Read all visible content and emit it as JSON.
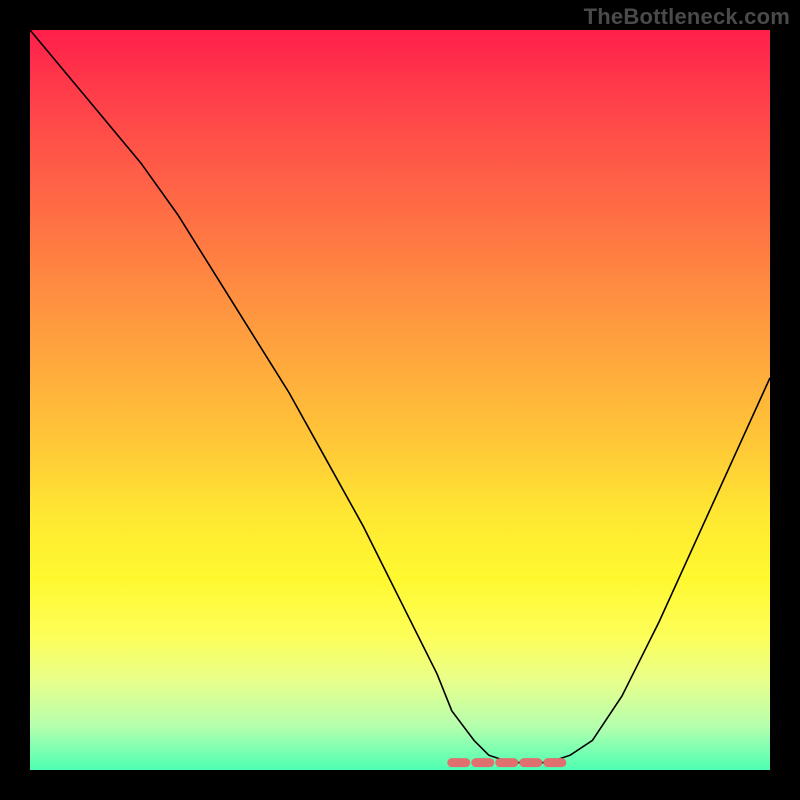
{
  "watermark": "TheBottleneck.com",
  "chart_data": {
    "type": "line",
    "title": "",
    "xlabel": "",
    "ylabel": "",
    "xlim": [
      0,
      100
    ],
    "ylim": [
      0,
      100
    ],
    "series": [
      {
        "name": "curve",
        "x": [
          0,
          5,
          10,
          15,
          20,
          25,
          30,
          35,
          40,
          45,
          50,
          55,
          57,
          60,
          62,
          65,
          67,
          70,
          73,
          76,
          80,
          85,
          90,
          95,
          100
        ],
        "values": [
          100,
          94,
          88,
          82,
          75,
          67,
          59,
          51,
          42,
          33,
          23,
          13,
          8,
          4,
          2,
          1,
          1,
          1,
          2,
          4,
          10,
          20,
          31,
          42,
          53
        ]
      }
    ],
    "flat_segment": {
      "x_start": 57,
      "x_end": 73,
      "y": 1,
      "color": "#e07070",
      "thickness": 3
    },
    "colors": {
      "gradient_top": "#ff1f4b",
      "gradient_mid": "#ffe932",
      "gradient_bottom": "#4dffb3",
      "curve": "#000000",
      "frame": "#000000"
    }
  }
}
